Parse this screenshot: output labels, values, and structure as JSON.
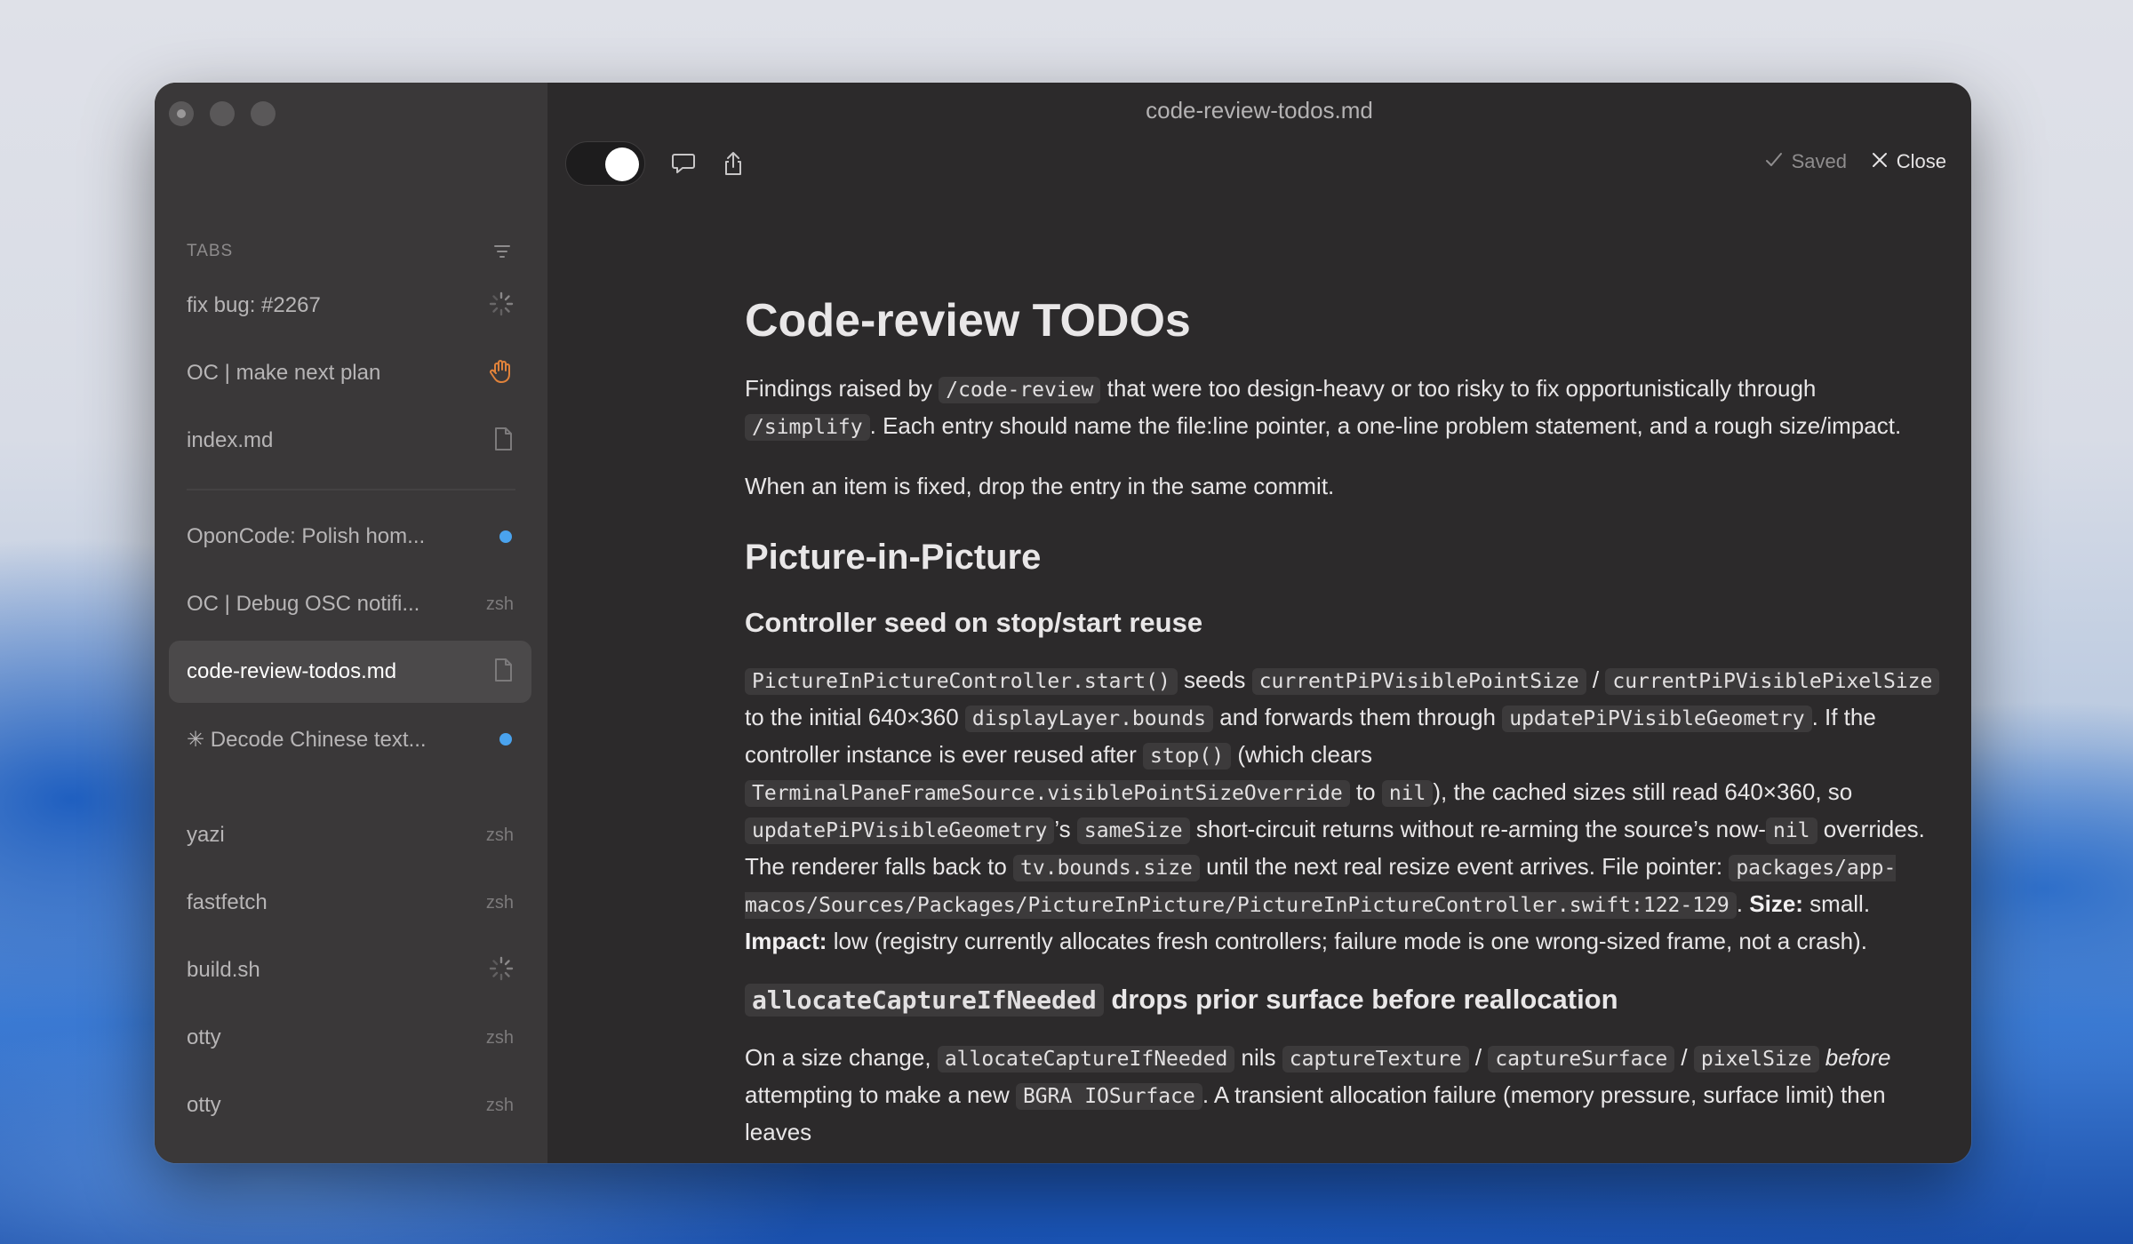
{
  "window": {
    "title": "code-review-todos.md"
  },
  "sidebar": {
    "header": "TABS",
    "items": [
      {
        "label": "fix bug: #2267",
        "indicator": "spinner-icon"
      },
      {
        "label": "OC | make next plan",
        "indicator": "hand-icon"
      },
      {
        "label": "index.md",
        "indicator": "document-icon"
      },
      {
        "label": "OponCode: Polish hom...",
        "indicator": "blue-dot"
      },
      {
        "label": "OC | Debug OSC notifi...",
        "indicator": "zsh"
      },
      {
        "label": "code-review-todos.md",
        "indicator": "document-icon",
        "active": true
      },
      {
        "label": "✳ Decode Chinese text...",
        "indicator": "blue-dot"
      },
      {
        "label": "yazi",
        "indicator": "zsh"
      },
      {
        "label": "fastfetch",
        "indicator": "zsh"
      },
      {
        "label": "build.sh",
        "indicator": "spinner-icon"
      },
      {
        "label": "otty",
        "indicator": "zsh"
      },
      {
        "label": "otty",
        "indicator": "zsh"
      }
    ],
    "zsh_label": "zsh"
  },
  "toolbar": {
    "saved_label": "Saved",
    "close_label": "Close"
  },
  "doc": {
    "h1": "Code-review TODOs",
    "p1": {
      "t1": "Findings raised by ",
      "c1": "/code-review",
      "t2": " that were too design-heavy or too risky to fix opportunistically through ",
      "c2": "/simplify",
      "t3": ". Each entry should name the file:line pointer, a one-line problem statement, and a rough size/impact."
    },
    "p2": "When an item is fixed, drop the entry in the same commit.",
    "h2": "Picture-in-Picture",
    "h3a": "Controller seed on stop/start reuse",
    "p3": {
      "c1": "PictureInPictureController.start()",
      "t1": " seeds ",
      "c2": "currentPiPVisiblePointSize",
      "t2": " / ",
      "c3": "currentPiPVisiblePixelSize",
      "t3": " to the initial 640×360 ",
      "c4": "displayLayer.bounds",
      "t4": " and forwards them through ",
      "c5": "updatePiPVisibleGeometry",
      "t5": ". If the controller instance is ever reused after ",
      "c6": "stop()",
      "t6": " (which clears ",
      "c7": "TerminalPaneFrameSource.visiblePointSizeOverride",
      "t7": " to ",
      "c8": "nil",
      "t8": "), the cached sizes still read 640×360, so ",
      "c9": "updatePiPVisibleGeometry",
      "t9": "’s ",
      "c10": "sameSize",
      "t10": " short-circuit returns without re-arming the source’s now-",
      "c11": "nil",
      "t11": " overrides. The renderer falls back to ",
      "c12": "tv.bounds.size",
      "t12": " until the next real resize event arrives. File pointer: ",
      "c13": "packages/app-macos/Sources/Packages/PictureInPicture/PictureInPictureController.swift:122-129",
      "t13": ".",
      "b1": "Size:",
      "t14": " small. ",
      "b2": "Impact:",
      "t15": " low (registry currently allocates fresh controllers; failure mode is one wrong-sized frame, not a crash)."
    },
    "h3b": {
      "code": "allocateCaptureIfNeeded",
      "text": " drops prior surface before reallocation"
    },
    "p4": {
      "t1": "On a size change, ",
      "c1": "allocateCaptureIfNeeded",
      "t2": " nils ",
      "c2": "captureTexture",
      "t3": " / ",
      "c3": "captureSurface",
      "t4": " / ",
      "c4": "pixelSize",
      "t5": " ",
      "i1": "before",
      "t6": " attempting to make a new ",
      "c5": "BGRA IOSurface",
      "t7": ". A transient allocation failure (memory pressure, surface limit) then leaves"
    }
  }
}
